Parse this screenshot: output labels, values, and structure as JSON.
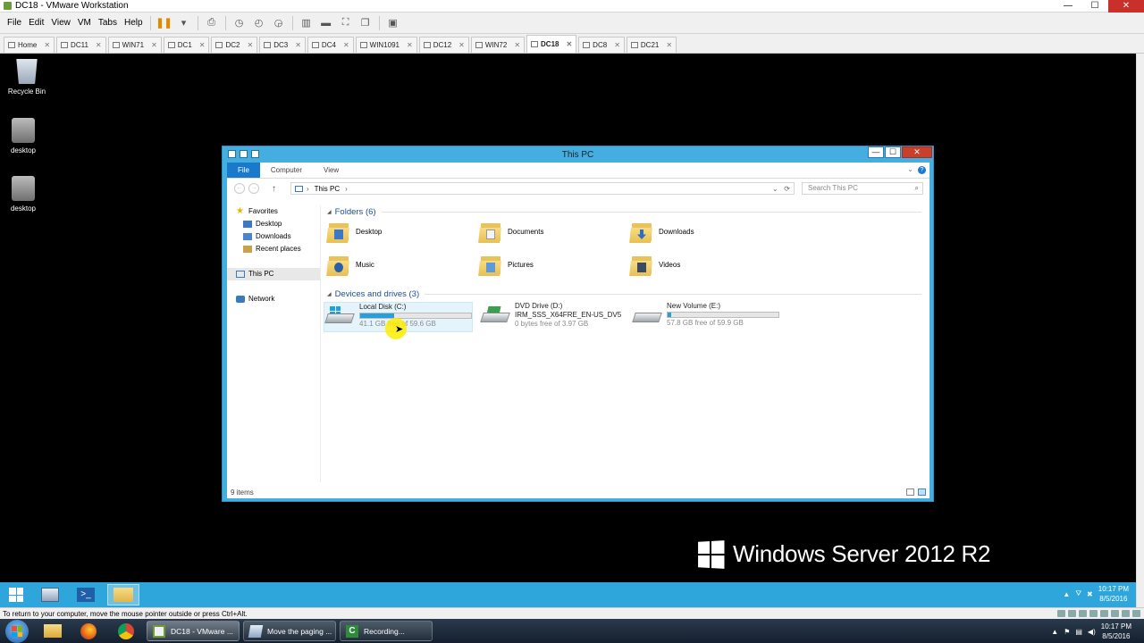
{
  "vmware": {
    "title": "DC18 - VMware Workstation",
    "window_controls": {
      "minimize": "—",
      "maximize": "☐",
      "close": "✕"
    },
    "menu": [
      "File",
      "Edit",
      "View",
      "VM",
      "Tabs",
      "Help"
    ],
    "tabs": [
      {
        "label": "Home",
        "active": false
      },
      {
        "label": "DC11",
        "active": false
      },
      {
        "label": "WIN71",
        "active": false
      },
      {
        "label": "DC1",
        "active": false
      },
      {
        "label": "DC2",
        "active": false
      },
      {
        "label": "DC3",
        "active": false
      },
      {
        "label": "DC4",
        "active": false
      },
      {
        "label": "WIN1091",
        "active": false
      },
      {
        "label": "DC12",
        "active": false
      },
      {
        "label": "WIN72",
        "active": false
      },
      {
        "label": "DC18",
        "active": true
      },
      {
        "label": "DC8",
        "active": false
      },
      {
        "label": "DC21",
        "active": false
      }
    ],
    "status_text": "To return to your computer, move the mouse pointer outside or press Ctrl+Alt."
  },
  "desktop": {
    "icons": [
      {
        "label": "Recycle Bin",
        "icon": "recycle-bin-icon"
      },
      {
        "label": "desktop",
        "icon": "computer-icon"
      },
      {
        "label": "desktop",
        "icon": "computer-icon"
      }
    ],
    "brand": "Windows Server 2012 R2"
  },
  "explorer": {
    "title": "This PC",
    "window_controls": {
      "minimize": "—",
      "maximize": "☐",
      "close": "✕"
    },
    "ribbon_tabs": [
      "File",
      "Computer",
      "View"
    ],
    "help": "?",
    "address": {
      "crumb": "This PC",
      "separator": "›"
    },
    "search_placeholder": "Search This PC",
    "nav": {
      "favorites": "Favorites",
      "favorites_items": [
        "Desktop",
        "Downloads",
        "Recent places"
      ],
      "this_pc": "This PC",
      "network": "Network"
    },
    "folders_header": "Folders (6)",
    "folders": [
      "Desktop",
      "Documents",
      "Downloads",
      "Music",
      "Pictures",
      "Videos"
    ],
    "drives_header": "Devices and drives (3)",
    "drives": [
      {
        "name": "Local Disk (C:)",
        "free": "41.1 GB free of 59.6 GB",
        "used_fraction": 0.31,
        "has_bar": true
      },
      {
        "name": "DVD Drive (D:)",
        "label": "IRM_SSS_X64FRE_EN-US_DV5",
        "free": "0 bytes free of 3.97 GB",
        "has_bar": false
      },
      {
        "name": "New Volume (E:)",
        "free": "57.8 GB free of 59.9 GB",
        "used_fraction": 0.035,
        "has_bar": true
      }
    ],
    "status": "9 items"
  },
  "guest_taskbar": {
    "time": "10:17 PM",
    "date": "8/5/2016"
  },
  "host_taskbar": {
    "tasks": [
      "DC18 - VMware ...",
      "Move the paging ...",
      "Recording..."
    ],
    "time": "10:17 PM",
    "date": "8/5/2016"
  },
  "colors": {
    "accent": "#44aee0",
    "file_tab": "#1979ca",
    "drive_bar": "#26a0da",
    "guest_taskbar": "#2fa6db"
  }
}
